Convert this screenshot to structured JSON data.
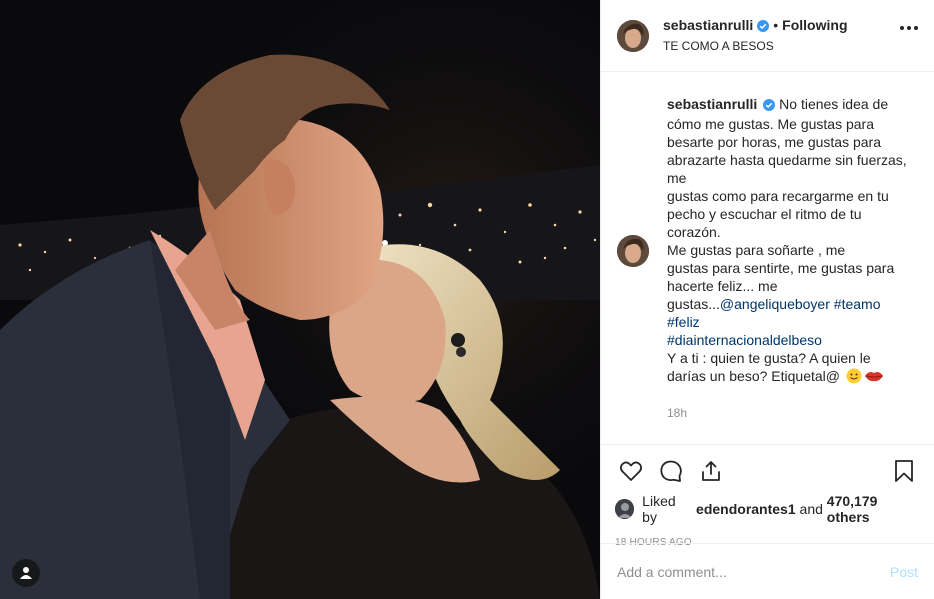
{
  "header": {
    "username": "sebastianrulli",
    "follow_status": "Following",
    "separator": "•",
    "subtitle": "TE COMO A BESOS"
  },
  "caption": {
    "username": "sebastianrulli",
    "lines": [
      "No tienes idea de",
      "cómo me gustas. Me gustas para",
      "besarte por horas, me gustas para",
      "abrazarte hasta quedarme sin fuerzas,",
      "me",
      "gustas como para recargarme en tu",
      "pecho y escuchar el ritmo de tu",
      "corazón.",
      "Me gustas para soñarte , me",
      "gustas para sentirte, me gustas para",
      "hacerte feliz... me"
    ],
    "last_text": "gustas...",
    "mention": "@angeliqueboyer",
    "tag_teamo": "#teamo",
    "tag_feliz": "#feliz",
    "tag_dia": "#diainternacionaldelbeso",
    "closing_1": "Y a ti : quien te gusta? A quien le",
    "closing_2": "darías un beso? Etiquetal@",
    "time": "18h"
  },
  "likes": {
    "prefix": "Liked by",
    "liker": "edendorantes1",
    "middle": "and",
    "count": "470,179 others"
  },
  "posted_time": "18 HOURS AGO",
  "add_comment": {
    "placeholder": "Add a comment...",
    "post_label": "Post"
  },
  "colors": {
    "link": "#003569",
    "verified": "#3897f0",
    "muted": "#8e8e8e",
    "post_disabled": "#b2dffc"
  },
  "icons": [
    "heart-icon",
    "comment-icon",
    "share-icon",
    "bookmark-icon",
    "more-options-icon",
    "user-tag-icon",
    "verified-badge-icon",
    "smile-emoji-icon",
    "lips-emoji-icon"
  ]
}
